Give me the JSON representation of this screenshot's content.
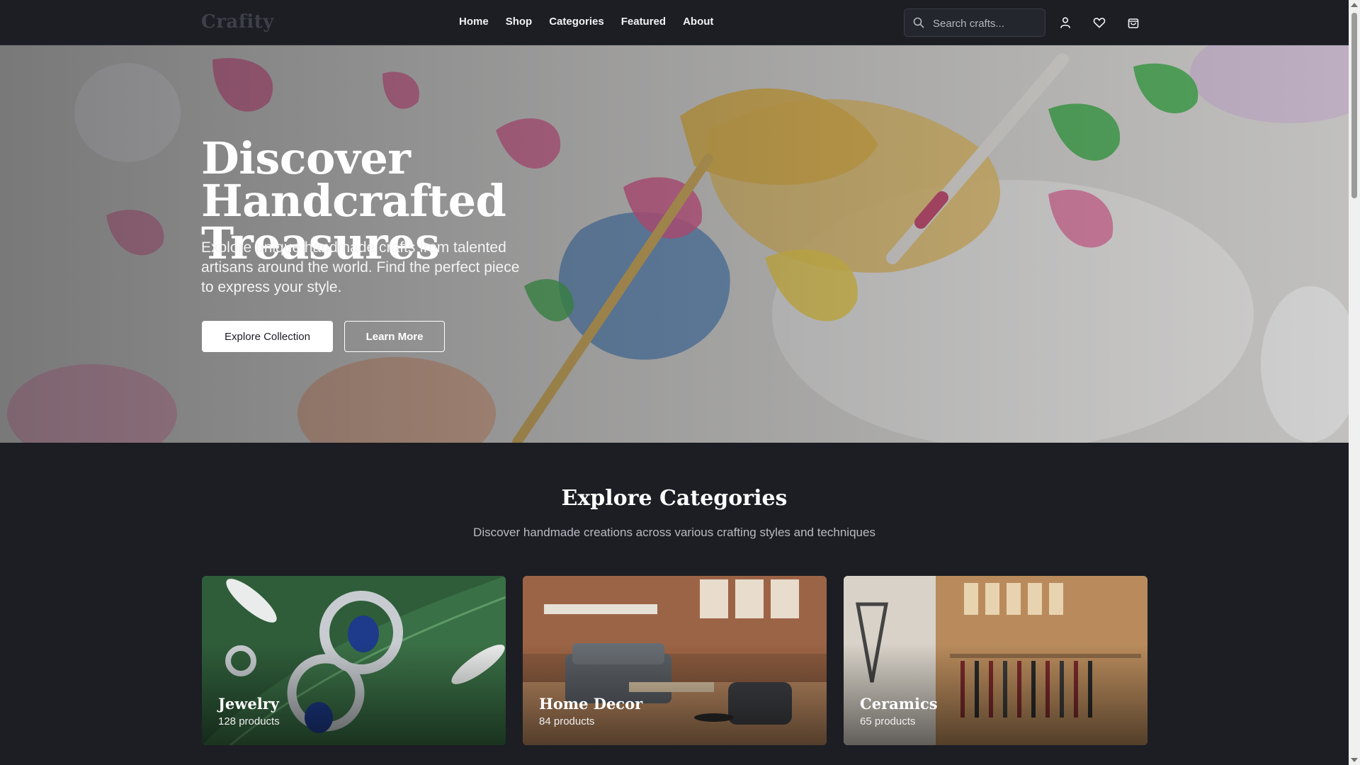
{
  "header": {
    "logo": "Crafity",
    "nav": [
      "Home",
      "Shop",
      "Categories",
      "Featured",
      "About"
    ],
    "search_placeholder": "Search crafts...",
    "icons": [
      "user-icon",
      "heart-icon",
      "cart-icon"
    ]
  },
  "hero": {
    "title": "Discover Handcrafted Treasures",
    "subtitle": "Explore unique handmade crafts from talented artisans around the world. Find the perfect piece to express your style.",
    "primary_button": "Explore Collection",
    "secondary_button": "Learn More"
  },
  "categories_section": {
    "title": "Explore Categories",
    "subtitle": "Discover handmade creations across various crafting styles and techniques",
    "cards": [
      {
        "title": "Jewelry",
        "count": "128 products"
      },
      {
        "title": "Home Decor",
        "count": "84 products"
      },
      {
        "title": "Ceramics",
        "count": "65 products"
      }
    ]
  },
  "colors": {
    "background": "#1c1e24",
    "header_border": "#2c2f37",
    "text_primary": "#ffffff",
    "text_muted": "#b9bbc2"
  }
}
